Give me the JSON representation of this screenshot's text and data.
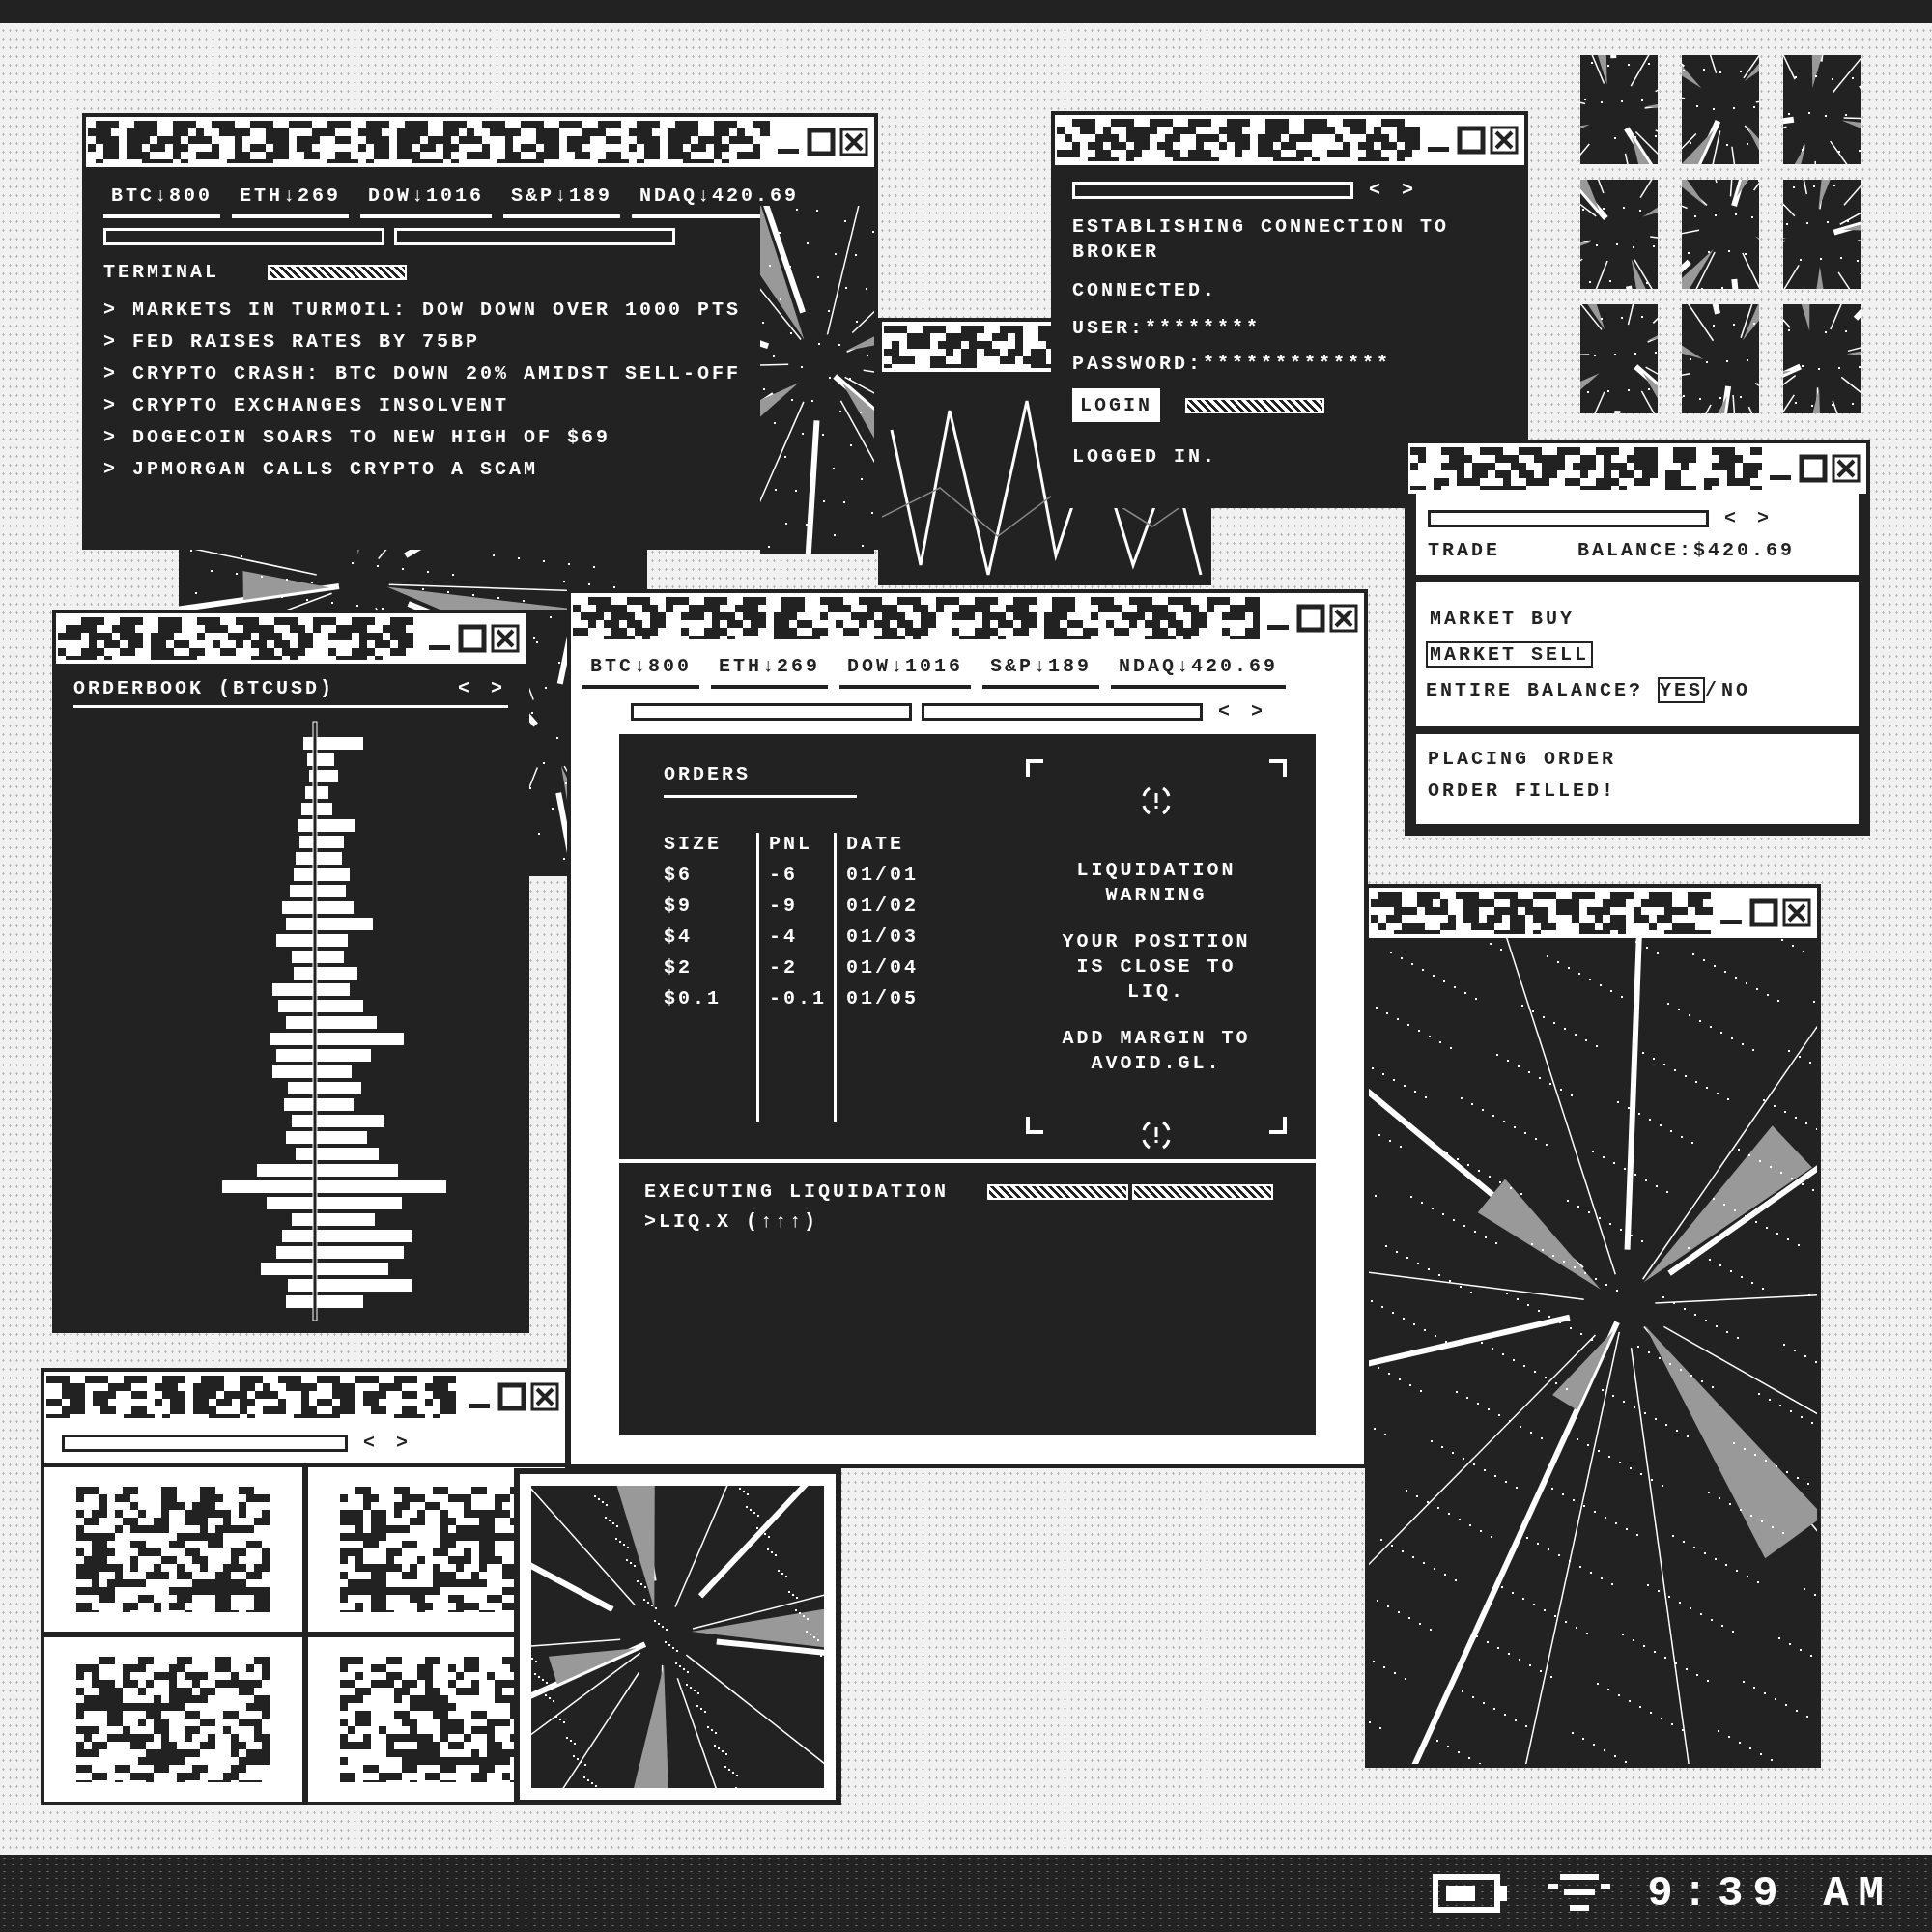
{
  "terminal_window": {
    "ticker": [
      "BTC↓800",
      "ETH↓269",
      "DOW↓1016",
      "S&P↓189",
      "NDAQ↓420.69"
    ],
    "heading": "TERMINAL",
    "progress": {
      "level": 1
    },
    "lines": [
      "> MARKETS IN TURMOIL: DOW DOWN OVER 1000 PTS",
      "> FED RAISES RATES BY 75BP",
      "> CRYPTO CRASH: BTC DOWN 20% AMIDST SELL-OFF",
      "> CRYPTO EXCHANGES INSOLVENT",
      "> DOGECOIN SOARS TO NEW HIGH OF $69",
      "> JPMORGAN CALLS CRYPTO A SCAM"
    ]
  },
  "login_window": {
    "nav": [
      "<",
      ">"
    ],
    "messages": [
      "ESTABLISHING CONNECTION TO BROKER",
      "CONNECTED."
    ],
    "fields": [
      {
        "label": "USER:",
        "value": "********"
      },
      {
        "label": "PASSWORD:",
        "value": "*************"
      }
    ],
    "login_button": "LOGIN",
    "progress": {
      "level": 1
    },
    "status": "LOGGED IN."
  },
  "trade_window": {
    "nav": [
      "<",
      ">"
    ],
    "heading": "TRADE",
    "balance": "BALANCE:$420.69",
    "options": [
      {
        "label": "MARKET BUY",
        "selected": false
      },
      {
        "label": "MARKET SELL",
        "selected": true
      }
    ],
    "confirm": {
      "prompt": "ENTIRE BALANCE?",
      "choices": [
        {
          "label": "YES",
          "selected": true
        },
        {
          "label": "NO",
          "selected": false
        }
      ],
      "separator": "/"
    },
    "log": [
      "PLACING ORDER",
      "ORDER FILLED!"
    ]
  },
  "orderbook_window": {
    "title": "ORDERBOOK (BTCUSD)",
    "nav": [
      "<",
      ">"
    ]
  },
  "main_window": {
    "ticker": [
      "BTC↓800",
      "ETH↓269",
      "DOW↓1016",
      "S&P↓189",
      "NDAQ↓420.69"
    ],
    "nav": [
      "<",
      ">"
    ],
    "orders": {
      "title": "ORDERS",
      "columns": [
        "SIZE",
        "PNL",
        "DATE"
      ],
      "rows": [
        [
          "$6",
          "-6",
          "01/01"
        ],
        [
          "$9",
          "-9",
          "01/02"
        ],
        [
          "$4",
          "-4",
          "01/03"
        ],
        [
          "$2",
          "-2",
          "01/04"
        ],
        [
          "$0.1",
          "-0.1",
          "01/05"
        ]
      ]
    },
    "warning": {
      "title": "LIQUIDATION WARNING",
      "message": "YOUR POSITION IS CLOSE TO LIQ.",
      "advice": "ADD MARGIN TO AVOID.GL."
    },
    "console": {
      "lines": [
        "EXECUTING LIQUIDATION",
        ">LIQ.X (↑↑↑)"
      ],
      "progress": [
        {
          "level": 1
        },
        {
          "level": 1
        }
      ]
    }
  },
  "browser_window": {
    "nav": [
      "<",
      ">"
    ]
  },
  "taskbar": {
    "clock": "9:39 AM"
  }
}
